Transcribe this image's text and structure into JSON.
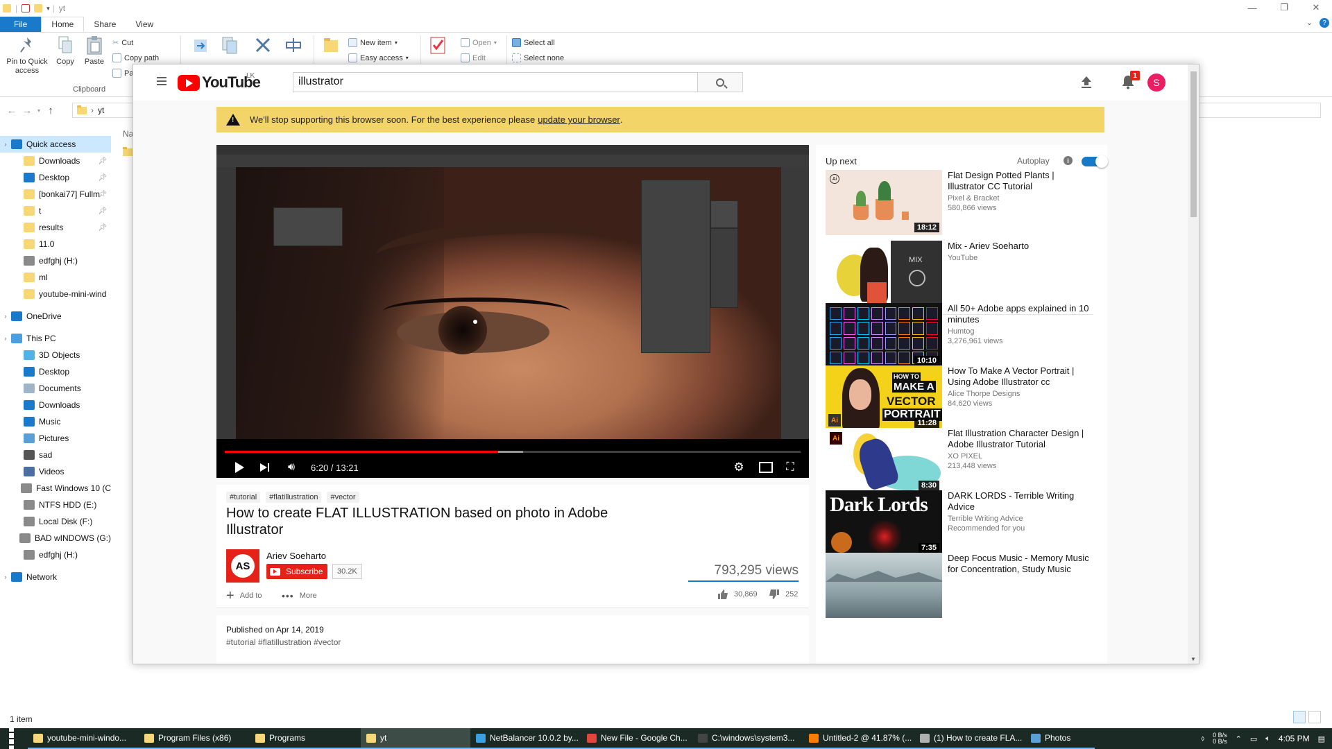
{
  "explorer": {
    "path_title": "yt",
    "tabs": [
      "File",
      "Home",
      "Share",
      "View"
    ],
    "ribbon": {
      "pin_label_1": "Pin to Quick",
      "pin_label_2": "access",
      "copy": "Copy",
      "paste": "Paste",
      "cut": "Cut",
      "copy_path": "Copy path",
      "paste_shortcut": "Pa",
      "clipboard_group": "Clipboard",
      "new_item": "New item",
      "easy_access": "Easy access",
      "open": "Open",
      "edit": "Edit",
      "select_all": "Select all",
      "select_none": "Select none"
    },
    "address": "yt",
    "content_header": "Na",
    "nav": [
      {
        "label": "Quick access",
        "icon": "star-icon",
        "color": "#1979ca",
        "chev": true,
        "selected": true
      },
      {
        "label": "Downloads",
        "icon": "folder-icon",
        "color": "#f8d775",
        "pin": true
      },
      {
        "label": "Desktop",
        "icon": "desktop-icon",
        "color": "#1979ca",
        "pin": true
      },
      {
        "label": "[bonkai77] Fullm",
        "icon": "folder-icon",
        "color": "#f8d775",
        "pin": true
      },
      {
        "label": "t",
        "icon": "folder-icon",
        "color": "#f8d775",
        "pin": true
      },
      {
        "label": "results",
        "icon": "folder-icon",
        "color": "#f8d775",
        "pin": true
      },
      {
        "label": "11.0",
        "icon": "folder-icon",
        "color": "#f8d775"
      },
      {
        "label": "edfghj (H:)",
        "icon": "drive-icon",
        "color": "#8a8a8a"
      },
      {
        "label": "ml",
        "icon": "folder-icon",
        "color": "#f8d775"
      },
      {
        "label": "youtube-mini-wind",
        "icon": "folder-icon",
        "color": "#f8d775"
      },
      {
        "gap": true
      },
      {
        "label": "OneDrive",
        "icon": "cloud-icon",
        "color": "#1979ca",
        "chev": true
      },
      {
        "gap": true
      },
      {
        "label": "This PC",
        "icon": "pc-icon",
        "color": "#4a9fe0",
        "chev": true
      },
      {
        "label": "3D Objects",
        "icon": "cube-icon",
        "color": "#4fb3e8"
      },
      {
        "label": "Desktop",
        "icon": "desktop-icon",
        "color": "#1979ca"
      },
      {
        "label": "Documents",
        "icon": "document-icon",
        "color": "#9fb5c8"
      },
      {
        "label": "Downloads",
        "icon": "download-icon",
        "color": "#1979ca"
      },
      {
        "label": "Music",
        "icon": "music-icon",
        "color": "#1979ca"
      },
      {
        "label": "Pictures",
        "icon": "picture-icon",
        "color": "#5aa0d6"
      },
      {
        "label": "sad",
        "icon": "drive-icon",
        "color": "#555555"
      },
      {
        "label": "Videos",
        "icon": "video-icon",
        "color": "#4a6fa0"
      },
      {
        "label": "Fast Windows 10 (C",
        "icon": "drive-icon",
        "color": "#8a8a8a"
      },
      {
        "label": "NTFS HDD (E:)",
        "icon": "drive-icon",
        "color": "#8a8a8a"
      },
      {
        "label": "Local Disk (F:)",
        "icon": "drive-icon",
        "color": "#8a8a8a"
      },
      {
        "label": "BAD wINDOWS (G:)",
        "icon": "drive-icon",
        "color": "#8a8a8a"
      },
      {
        "label": "edfghj (H:)",
        "icon": "drive-icon",
        "color": "#8a8a8a"
      },
      {
        "gap": true
      },
      {
        "label": "Network",
        "icon": "network-icon",
        "color": "#1979ca",
        "chev": true
      }
    ],
    "status": "1 item"
  },
  "youtube": {
    "logo_text": "YouTube",
    "country": "LK",
    "search_value": "illustrator",
    "notification_count": "1",
    "avatar_letter": "S",
    "warning_text": "We'll stop supporting this browser soon. For the best experience please",
    "warning_link": "update your browser",
    "warning_end": ".",
    "player": {
      "time": "6:20 / 13:21",
      "played_fraction": 0.4743
    },
    "video": {
      "tags": [
        "#tutorial",
        "#flatillustration",
        "#vector"
      ],
      "title": "How to create FLAT ILLUSTRATION based on photo in Adobe Illustrator",
      "channel": "Ariev Soeharto",
      "channel_initials": "AS",
      "subscribe": "Subscribe",
      "subscribers": "30.2K",
      "views": "793,295 views",
      "add_to": "Add to",
      "more": "More",
      "likes": "30,869",
      "dislikes": "252",
      "like_fraction": 0.9919,
      "published": "Published on Apr 14, 2019",
      "desc_tags": "#tutorial #flatillustration #vector"
    },
    "sidebar": {
      "up_next": "Up next",
      "autoplay": "Autoplay",
      "recs": [
        {
          "title": "Flat Design Potted Plants | Illustrator CC Tutorial",
          "meta1": "Pixel & Bracket",
          "meta2": "580,866 views",
          "duration": "18:12",
          "thumb": "plants"
        },
        {
          "title": "Mix - Ariev Soeharto",
          "meta1": "YouTube",
          "meta2": "",
          "duration": "",
          "thumb": "mix"
        },
        {
          "title": "All 50+ Adobe apps explained in 10 minutes",
          "meta1": "Humtog",
          "meta2": "3,276,961 views",
          "duration": "10:10",
          "thumb": "adobe"
        },
        {
          "title": "How To Make A Vector Portrait | Using Adobe Illustrator cc",
          "meta1": "Alice Thorpe Designs",
          "meta2": "84,620 views",
          "duration": "11:28",
          "thumb": "portrait"
        },
        {
          "title": "Flat Illustration Character Design | Adobe Illustrator Tutorial",
          "meta1": "XO PIXEL",
          "meta2": "213,448 views",
          "duration": "8:30",
          "thumb": "character"
        },
        {
          "title": "DARK LORDS - Terrible Writing Advice",
          "meta1": "Terrible Writing Advice",
          "meta2": "Recommended for you",
          "duration": "7:35",
          "thumb": "dark"
        },
        {
          "title": "Deep Focus Music - Memory Music for Concentration, Study Music",
          "meta1": "",
          "meta2": "",
          "duration": "",
          "thumb": "focus"
        }
      ],
      "thumb_texts": {
        "mix": "MIX",
        "portrait_1": "HOW TO",
        "portrait_2": "MAKE A",
        "portrait_3": "VECTOR",
        "portrait_4": "PORTRAIT",
        "dark": "Dark Lords",
        "ai_badge": "Ai"
      }
    }
  },
  "taskbar": {
    "items": [
      {
        "label": "youtube-mini-windo...",
        "color": "#f8d775",
        "state": "open"
      },
      {
        "label": "Program Files (x86)",
        "color": "#f8d775",
        "state": "open"
      },
      {
        "label": "Programs",
        "color": "#f8d775",
        "state": "open"
      },
      {
        "label": "yt",
        "color": "#f8d775",
        "state": "active"
      },
      {
        "label": "NetBalancer 10.0.2 by...",
        "color": "#3aa0e0",
        "state": "open"
      },
      {
        "label": "New File - Google Ch...",
        "color": "#e0463b",
        "state": "open"
      },
      {
        "label": "C:\\windows\\system3...",
        "color": "#444444",
        "state": "open"
      },
      {
        "label": "Untitled-2 @ 41.87% (...",
        "color": "#ff7c00",
        "state": "open"
      },
      {
        "label": "(1) How to create FLA...",
        "color": "#b0b0b0",
        "state": "open"
      },
      {
        "label": "Photos",
        "color": "#5aa0d6",
        "state": "open"
      }
    ],
    "net_up": "0 B/s",
    "net_down": "0 B/s",
    "time": "4:05 PM"
  }
}
